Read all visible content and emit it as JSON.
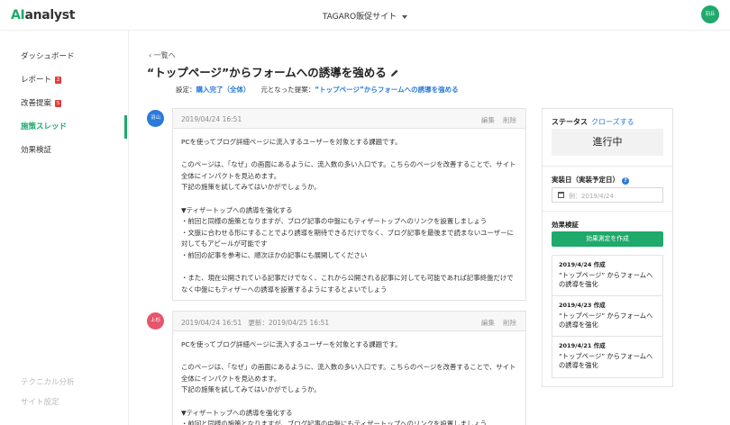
{
  "header": {
    "logo_ai": "AI",
    "logo_rest": "analyst",
    "site_name": "TAGARO販促サイト",
    "user_initials": "羽丘"
  },
  "sidebar": {
    "items": [
      {
        "label": "ダッシュボード"
      },
      {
        "label": "レポート",
        "badge": "2"
      },
      {
        "label": "改善提案",
        "badge": "5"
      },
      {
        "label": "施策スレッド"
      },
      {
        "label": "効果検証"
      }
    ],
    "bottom_items": [
      {
        "label": "テクニカル分析"
      },
      {
        "label": "サイト設定"
      }
    ]
  },
  "main": {
    "back_label": "一覧へ",
    "title": "“トップページ”からフォームへの誘導を強める",
    "setting_label": "設定：",
    "setting_value": "購入完了（全体）",
    "origin_label": "元となった提案：",
    "origin_value": "“トップページ”からフォームへの誘導を強める",
    "posts": [
      {
        "author": "羽山",
        "date": "2019/04/24 16:51",
        "updated": "",
        "edit_label": "編集",
        "delete_label": "削除",
        "paragraphs": [
          "PCを使ってブログ詳細ページに流入するユーザーを対象とする課題です。",
          "このページは、「なぜ」の画面にあるように、流入数の多い入口です。こちらのページを改善することで、サイト全体にインパクトを見込めます。\n下記の施策を試してみてはいかがでしょうか。",
          "▼ティザートップへの誘導を強化する\n・前回と同様の施策となりますが、ブログ記事の中盤にもティザートップへのリンクを設置しましょう\n・文脈に合わせる形にすることでより誘導を期待できるだけでなく、ブログ記事を最後まで読まないユーザーに対してもアピールが可能です\n・前回の記事を参考に、順次ほかの記事にも展開してください",
          "・また、現在公開されている記事だけでなく、これから公開される記事に対しても可能であれば記事終盤だけでなく中盤にもティザーへの誘導を設置するようにするとよいでしょう"
        ]
      },
      {
        "author": "上杉",
        "date": "2019/04/24 16:51",
        "updated": "更新：2019/04/25 16:51",
        "edit_label": "編集",
        "delete_label": "削除",
        "paragraphs": [
          "PCを使ってブログ詳細ページに流入するユーザーを対象とする課題です。",
          "このページは、「なぜ」の画面にあるように、流入数の多い入口です。こちらのページを改善することで、サイト全体にインパクトを見込めます。\n下記の施策を試してみてはいかがでしょうか。",
          "▼ティザートップへの誘導を強化する\n・前回と同様の施策となりますが、ブログ記事の中盤にもティザートップへのリンクを設置しましょう"
        ]
      }
    ]
  },
  "right_panel": {
    "status_label": "ステータス",
    "close_label": "クローズする",
    "status_value": "進行中",
    "date_label": "実装日（実装予定日）",
    "date_placeholder": "例：2019/4/24",
    "effect_label": "効果検証",
    "create_button": "効果測定を作成",
    "effects": [
      {
        "date": "2019/4/24 作成",
        "text": "“トップページ” からフォームへの誘導を強化"
      },
      {
        "date": "2019/4/23 作成",
        "text": "“トップページ” からフォームへの誘導を強化"
      },
      {
        "date": "2019/4/21 作成",
        "text": "“トップページ” からフォームへの誘導を強化"
      }
    ]
  },
  "colors": {
    "accent": "#1fa96b",
    "link": "#2a7ad9",
    "badge": "#e23c3c",
    "avatar_1": "#2a7ad9",
    "avatar_2": "#e5566b"
  },
  "icons": [
    "edit-pencil-icon",
    "chevron-left-icon",
    "caret-down-icon",
    "calendar-icon",
    "help-icon"
  ]
}
